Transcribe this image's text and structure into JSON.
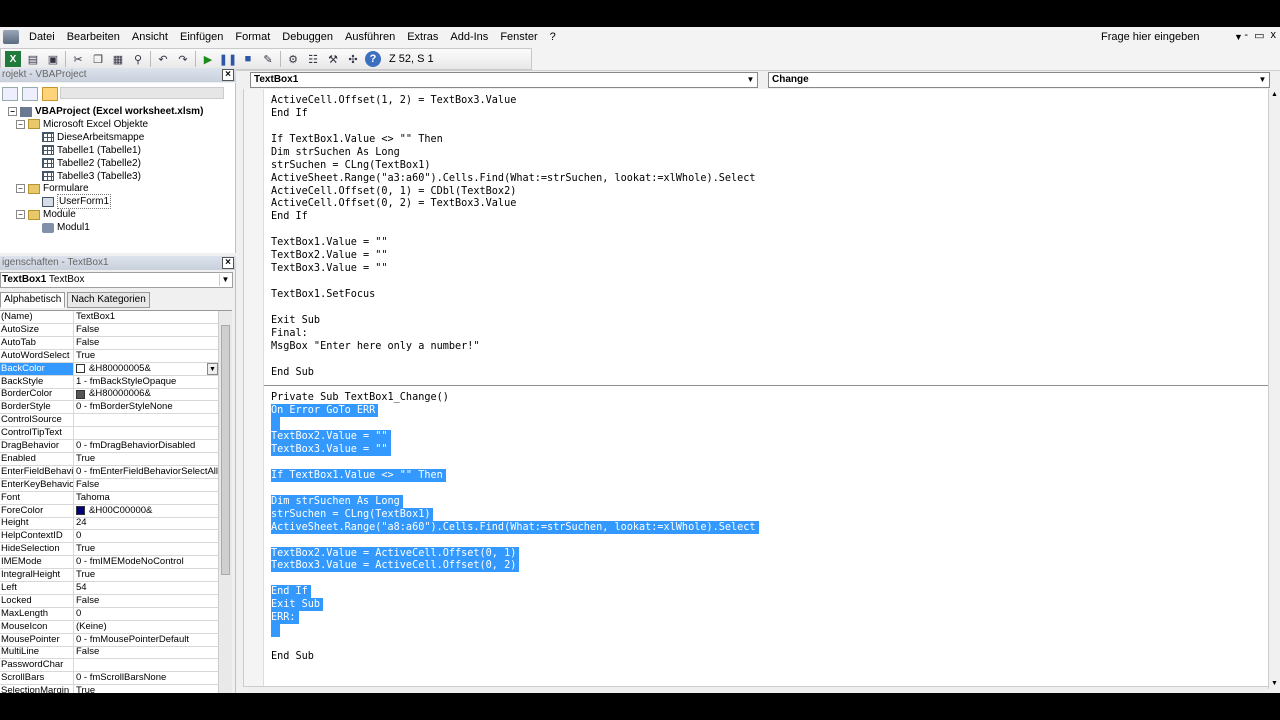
{
  "menu": {
    "items": [
      "Datei",
      "Bearbeiten",
      "Ansicht",
      "Einfügen",
      "Format",
      "Debuggen",
      "Ausführen",
      "Extras",
      "Add-Ins",
      "Fenster",
      "?"
    ],
    "help_placeholder": "Frage hier eingeben",
    "window_buttons": [
      "-",
      "▭",
      "x"
    ]
  },
  "toolbar": {
    "cursor_position": "Z 52, S 1"
  },
  "project_pane": {
    "title": "rojekt - VBAProject",
    "tree": [
      {
        "label": "VBAProject (Excel worksheet.xlsm)",
        "level": 0,
        "icon": "project-icon",
        "bold": true,
        "expander": "−"
      },
      {
        "label": "Microsoft Excel Objekte",
        "level": 1,
        "icon": "folder-icon",
        "expander": "−"
      },
      {
        "label": "DieseArbeitsmappe",
        "level": 2,
        "icon": "workbook-icon"
      },
      {
        "label": "Tabelle1 (Tabelle1)",
        "level": 2,
        "icon": "sheet-icon"
      },
      {
        "label": "Tabelle2 (Tabelle2)",
        "level": 2,
        "icon": "sheet-icon"
      },
      {
        "label": "Tabelle3 (Tabelle3)",
        "level": 2,
        "icon": "sheet-icon"
      },
      {
        "label": "Formulare",
        "level": 1,
        "icon": "folder-icon",
        "expander": "−"
      },
      {
        "label": "UserForm1",
        "level": 2,
        "icon": "form-icon",
        "outlined": true
      },
      {
        "label": "Module",
        "level": 1,
        "icon": "folder-icon",
        "expander": "−"
      },
      {
        "label": "Modul1",
        "level": 2,
        "icon": "module-icon"
      }
    ]
  },
  "properties_pane": {
    "title": "igenschaften - TextBox1",
    "object_name": "TextBox1",
    "object_type": "TextBox",
    "tabs": [
      "Alphabetisch",
      "Nach Kategorien"
    ],
    "rows": [
      {
        "name": "(Name)",
        "value": "TextBox1"
      },
      {
        "name": "AutoSize",
        "value": "False"
      },
      {
        "name": "AutoTab",
        "value": "False"
      },
      {
        "name": "AutoWordSelect",
        "value": "True"
      },
      {
        "name": "BackColor",
        "value": "&H80000005&",
        "swatch": "#ffffff",
        "selected": true,
        "dropdown": true
      },
      {
        "name": "BackStyle",
        "value": "1 - fmBackStyleOpaque"
      },
      {
        "name": "BorderColor",
        "value": "&H80000006&",
        "swatch": "#555555"
      },
      {
        "name": "BorderStyle",
        "value": "0 - fmBorderStyleNone"
      },
      {
        "name": "ControlSource",
        "value": ""
      },
      {
        "name": "ControlTipText",
        "value": ""
      },
      {
        "name": "DragBehavior",
        "value": "0 - fmDragBehaviorDisabled"
      },
      {
        "name": "Enabled",
        "value": "True"
      },
      {
        "name": "EnterFieldBehavior",
        "value": "0 - fmEnterFieldBehaviorSelectAll"
      },
      {
        "name": "EnterKeyBehavior",
        "value": "False"
      },
      {
        "name": "Font",
        "value": "Tahoma"
      },
      {
        "name": "ForeColor",
        "value": "&H00C00000&",
        "swatch": "#00007a"
      },
      {
        "name": "Height",
        "value": "24"
      },
      {
        "name": "HelpContextID",
        "value": "0"
      },
      {
        "name": "HideSelection",
        "value": "True"
      },
      {
        "name": "IMEMode",
        "value": "0 - fmIMEModeNoControl"
      },
      {
        "name": "IntegralHeight",
        "value": "True"
      },
      {
        "name": "Left",
        "value": "54"
      },
      {
        "name": "Locked",
        "value": "False"
      },
      {
        "name": "MaxLength",
        "value": "0"
      },
      {
        "name": "MouseIcon",
        "value": "(Keine)"
      },
      {
        "name": "MousePointer",
        "value": "0 - fmMousePointerDefault"
      },
      {
        "name": "MultiLine",
        "value": "False"
      },
      {
        "name": "PasswordChar",
        "value": ""
      },
      {
        "name": "ScrollBars",
        "value": "0 - fmScrollBarsNone"
      },
      {
        "name": "SelectionMargin",
        "value": "True"
      }
    ]
  },
  "code_window": {
    "object_combo": "TextBox1",
    "procedure_combo": "Change",
    "lines": [
      {
        "text": "ActiveCell.Offset(1, 2) = TextBox3.Value",
        "hl": false
      },
      {
        "text": "End If",
        "hl": false
      },
      {
        "text": "",
        "hl": false
      },
      {
        "text": "If TextBox1.Value <> \"\" Then",
        "hl": false
      },
      {
        "text": "Dim strSuchen As Long",
        "hl": false
      },
      {
        "text": "strSuchen = CLng(TextBox1)",
        "hl": false
      },
      {
        "text": "ActiveSheet.Range(\"a3:a60\").Cells.Find(What:=strSuchen, lookat:=xlWhole).Select",
        "hl": false
      },
      {
        "text": "ActiveCell.Offset(0, 1) = CDbl(TextBox2)",
        "hl": false
      },
      {
        "text": "ActiveCell.Offset(0, 2) = TextBox3.Value",
        "hl": false
      },
      {
        "text": "End If",
        "hl": false
      },
      {
        "text": "",
        "hl": false
      },
      {
        "text": "TextBox1.Value = \"\"",
        "hl": false
      },
      {
        "text": "TextBox2.Value = \"\"",
        "hl": false
      },
      {
        "text": "TextBox3.Value = \"\"",
        "hl": false
      },
      {
        "text": "",
        "hl": false
      },
      {
        "text": "TextBox1.SetFocus",
        "hl": false
      },
      {
        "text": "",
        "hl": false
      },
      {
        "text": "Exit Sub",
        "hl": false
      },
      {
        "text": "Final:",
        "hl": false
      },
      {
        "text": "MsgBox \"Enter here only a number!\"",
        "hl": false
      },
      {
        "text": "",
        "hl": false
      },
      {
        "text": "End Sub",
        "hl": false
      },
      {
        "text": "",
        "hl": false
      },
      {
        "text": "Private Sub TextBox1_Change()",
        "hl": false
      },
      {
        "text": "On Error GoTo ERR",
        "hl": true
      },
      {
        "text": " ",
        "hl": true
      },
      {
        "text": "TextBox2.Value = \"\"",
        "hl": true
      },
      {
        "text": "TextBox3.Value = \"\"",
        "hl": true
      },
      {
        "text": "",
        "hl": false
      },
      {
        "text": "If TextBox1.Value <> \"\" Then",
        "hl": true
      },
      {
        "text": "",
        "hl": false
      },
      {
        "text": "Dim strSuchen As Long",
        "hl": true
      },
      {
        "text": "strSuchen = CLng(TextBox1)",
        "hl": true
      },
      {
        "text": "ActiveSheet.Range(\"a8:a60\").Cells.Find(What:=strSuchen, lookat:=xlWhole).Select",
        "hl": true
      },
      {
        "text": "",
        "hl": false
      },
      {
        "text": "TextBox2.Value = ActiveCell.Offset(0, 1)",
        "hl": true
      },
      {
        "text": "TextBox3.Value = ActiveCell.Offset(0, 2)",
        "hl": true
      },
      {
        "text": "",
        "hl": false
      },
      {
        "text": "End If",
        "hl": true
      },
      {
        "text": "Exit Sub",
        "hl": true
      },
      {
        "text": "ERR:",
        "hl": true
      },
      {
        "text": " ",
        "hl": true
      },
      {
        "text": "",
        "hl": false
      },
      {
        "text": "End Sub",
        "hl": false
      }
    ]
  }
}
